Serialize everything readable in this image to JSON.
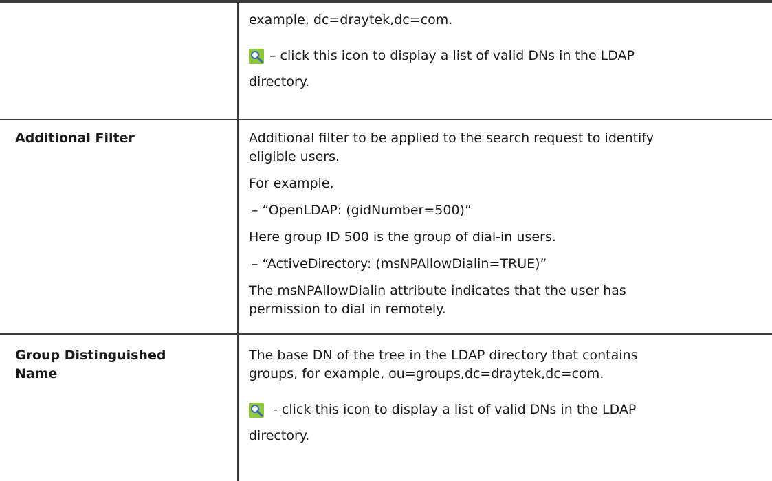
{
  "rows": {
    "base_dn_partial": {
      "text_line1": "example, dc=draytek,dc=com.",
      "icon": "ldap-search-icon",
      "icon_desc_line1": "–  click this icon to display a list of valid DNs in the LDAP",
      "icon_desc_line2": "directory."
    },
    "additional_filter": {
      "label": "Additional Filter",
      "desc_line1": "Additional filter to be applied to the search request to identify",
      "desc_line2": "eligible users.",
      "for_example": "For example,",
      "example1": "–  “OpenLDAP: (gidNumber=500)”",
      "note1": "Here group ID 500 is the group of dial-in users.",
      "example2": "–  “ActiveDirectory: (msNPAllowDialin=TRUE)”",
      "note2_line1": "The msNPAllowDialin attribute indicates that the user has",
      "note2_line2": "permission to dial in remotely."
    },
    "group_dn": {
      "label_line1": "Group Distinguished",
      "label_line2": "Name",
      "desc_line1": "The base DN of the tree in the LDAP directory that contains",
      "desc_line2": "groups, for example, ou=groups,dc=draytek,dc=com.",
      "icon": "ldap-search-icon",
      "icon_desc_line1": "- click this icon to display a list of valid DNs in the LDAP",
      "icon_desc_line2": "directory."
    }
  }
}
